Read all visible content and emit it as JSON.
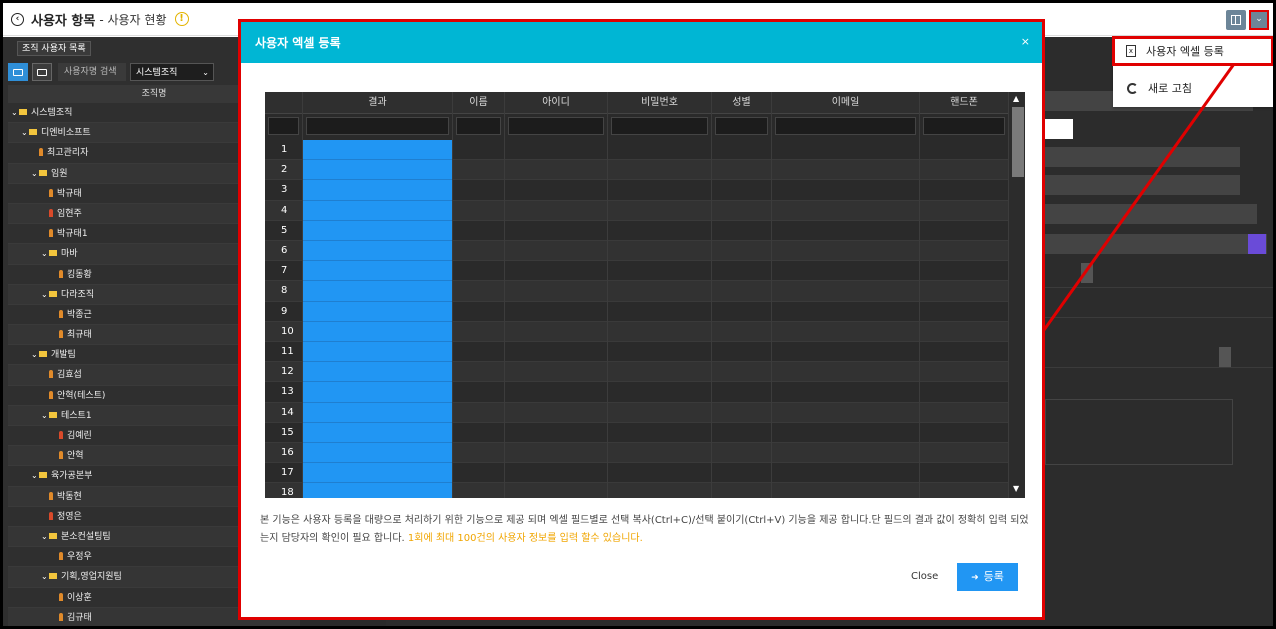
{
  "header": {
    "title": "사용자 항목",
    "subtitle": "- 사용자 현황",
    "info_glyph": "!",
    "back_glyph": "‹",
    "dropdown_glyph": "⌄"
  },
  "left": {
    "tab_label": "조직 사용자 목록",
    "search_label": "사용자명 검색",
    "org_select": "시스템조직",
    "column_header": "조직명",
    "tree": [
      {
        "label": "시스템조직",
        "type": "folder",
        "level": 0
      },
      {
        "label": "디엔비소프트",
        "type": "folder",
        "level": 1
      },
      {
        "label": "최고관리자",
        "type": "person",
        "level": 2
      },
      {
        "label": "임원",
        "type": "folder",
        "level": 2
      },
      {
        "label": "박규태",
        "type": "person",
        "level": 3
      },
      {
        "label": "임현주",
        "type": "person-red",
        "level": 3
      },
      {
        "label": "박규태1",
        "type": "person",
        "level": 3
      },
      {
        "label": "마바",
        "type": "folder",
        "level": 3
      },
      {
        "label": "킹동황",
        "type": "person",
        "level": 4
      },
      {
        "label": "다라조직",
        "type": "folder",
        "level": 3
      },
      {
        "label": "박종근",
        "type": "person",
        "level": 4
      },
      {
        "label": "최규태",
        "type": "person",
        "level": 4
      },
      {
        "label": "개발팀",
        "type": "folder",
        "level": 2
      },
      {
        "label": "김효섭",
        "type": "person",
        "level": 3
      },
      {
        "label": "안혁(테스트)",
        "type": "person",
        "level": 3
      },
      {
        "label": "테스트1",
        "type": "folder",
        "level": 3
      },
      {
        "label": "김예린",
        "type": "person-red",
        "level": 4
      },
      {
        "label": "안혁",
        "type": "person",
        "level": 4
      },
      {
        "label": "육가공본부",
        "type": "folder",
        "level": 2
      },
      {
        "label": "박동현",
        "type": "person",
        "level": 3
      },
      {
        "label": "정영은",
        "type": "person-red",
        "level": 3
      },
      {
        "label": "본소컨설팅팀",
        "type": "folder",
        "level": 3
      },
      {
        "label": "우정우",
        "type": "person",
        "level": 4
      },
      {
        "label": "기획,영업지원팀",
        "type": "folder",
        "level": 3
      },
      {
        "label": "이상훈",
        "type": "person",
        "level": 4
      },
      {
        "label": "김규태",
        "type": "person",
        "level": 4
      }
    ]
  },
  "menu": {
    "excel_register": "사용자 엑셀 등록",
    "refresh": "새로 고침"
  },
  "modal": {
    "title": "사용자 엑셀 등록",
    "close_glyph": "×",
    "columns": [
      "결과",
      "이름",
      "아이디",
      "비밀번호",
      "성별",
      "이메일",
      "핸드폰"
    ],
    "row_numbers": [
      "1",
      "2",
      "3",
      "4",
      "5",
      "6",
      "7",
      "8",
      "9",
      "10",
      "11",
      "12",
      "13",
      "14",
      "15",
      "16",
      "17",
      "18"
    ],
    "description": "본 기능은 사용자 등록을 대량으로 처리하기 위한 기능으로 제공 되며 엑셀 필드별로 선택 복사(Ctrl+C)/선택 붙이기(Ctrl+V) 기능을 제공 합니다.단 필드의 결과 값이 정확히 입력 되었는지 담당자의 확인이 필요 합니다.",
    "description_highlight": "1회에 최대 100건의 사용자 정보를 입력 할수 있습니다.",
    "close_label": "Close",
    "register_label": "등록"
  },
  "colors": {
    "accent": "#00b6d4",
    "primary": "#2196f3",
    "highlight_red": "#e00000",
    "warning": "#f0a500"
  }
}
